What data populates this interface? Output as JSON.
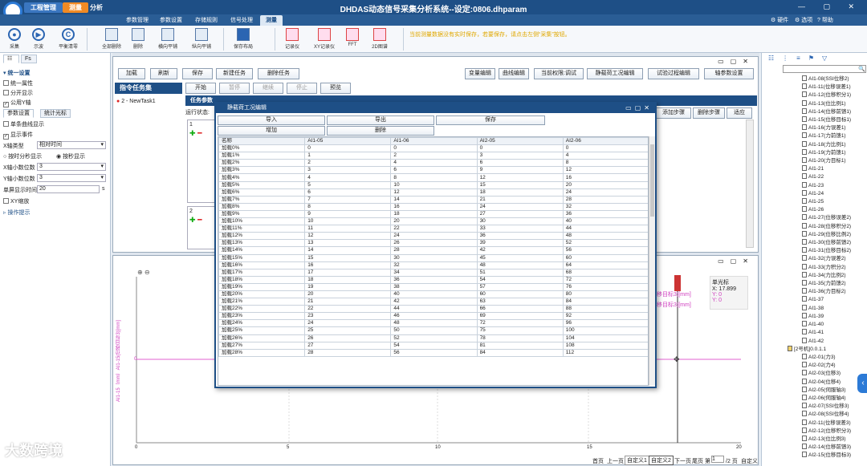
{
  "app": {
    "title": "DHDAS动态信号采集分析系统--设定:0806.dhparam",
    "pills": [
      "工程管理",
      "测量",
      "分析"
    ],
    "window_controls": "— ▢ ✕"
  },
  "menu": {
    "items": [
      "参数管理",
      "参数设置",
      "存储规则",
      "信号处理",
      "测量"
    ],
    "right": [
      "硬件",
      "选项",
      "帮助"
    ]
  },
  "ribbon": {
    "buttons": [
      "采集",
      "示波",
      "平衡清零",
      "全部删除",
      "删除",
      "横向平铺",
      "纵向平铺",
      "保存布局",
      "记录仪",
      "XY记录仪",
      "FFT",
      "2D图谱"
    ],
    "notice": "当前测量数据没有实时保存，若要保存，请点击左侧“采集”按钮。"
  },
  "left": {
    "tabs": [
      "Fs"
    ],
    "section": "统一设置",
    "items": [
      "统一属性",
      "分开显示",
      "公用Y轴"
    ],
    "subtabs": [
      "参数设置",
      "统计光标"
    ],
    "options": [
      "单条曲线显示",
      "显示事件"
    ],
    "xaxis_label": "X轴类型",
    "xaxis_value": "相对时间",
    "radio": [
      "按时分秒显示",
      "按秒显示"
    ],
    "xdec_label": "X轴小数位数",
    "xdec_value": "3",
    "ydec_label": "Y轴小数位数",
    "ydec_value": "3",
    "single_label": "单屏显示时间",
    "single_value": "20",
    "single_unit": "s",
    "xy_zoom": "XY缩放",
    "tips": "操作提示"
  },
  "topwin": {
    "toolbar": [
      "加载",
      "刷新",
      "保存",
      "新建任务",
      "删除任务"
    ],
    "right_toolbar": [
      "变量编辑",
      "曲线编辑",
      "当前权限:调试",
      "静载荷工况编辑",
      "试验过程编辑",
      "轴参数设置"
    ],
    "task_header": "指令任务集",
    "task": "2 - NewTask1",
    "exec": [
      "开始",
      "暂停",
      "继续",
      "停止",
      "预览"
    ],
    "task_param": "任务参数",
    "status": "运行状态:",
    "step_btns": [
      "添加步骤",
      "删除步骤",
      "适应"
    ],
    "step1": "1",
    "step2": "2"
  },
  "dialog": {
    "title": "静载荷工况编辑",
    "buttons": [
      "导入",
      "导出",
      "保存",
      "增加",
      "删除"
    ],
    "columns": [
      "名称",
      "AI1-05",
      "AI1-06",
      "AI2-05",
      "AI2-06"
    ],
    "rows": [
      [
        "加载0%",
        "0",
        "0",
        "0",
        "0"
      ],
      [
        "加载1%",
        "1",
        "2",
        "3",
        "4"
      ],
      [
        "加载2%",
        "2",
        "4",
        "6",
        "8"
      ],
      [
        "加载3%",
        "3",
        "6",
        "9",
        "12"
      ],
      [
        "加载4%",
        "4",
        "8",
        "12",
        "16"
      ],
      [
        "加载5%",
        "5",
        "10",
        "15",
        "20"
      ],
      [
        "加载6%",
        "6",
        "12",
        "18",
        "24"
      ],
      [
        "加载7%",
        "7",
        "14",
        "21",
        "28"
      ],
      [
        "加载8%",
        "8",
        "16",
        "24",
        "32"
      ],
      [
        "加载9%",
        "9",
        "18",
        "27",
        "36"
      ],
      [
        "加载10%",
        "10",
        "20",
        "30",
        "40"
      ],
      [
        "加载11%",
        "11",
        "22",
        "33",
        "44"
      ],
      [
        "加载12%",
        "12",
        "24",
        "36",
        "48"
      ],
      [
        "加载13%",
        "13",
        "26",
        "39",
        "52"
      ],
      [
        "加载14%",
        "14",
        "28",
        "42",
        "56"
      ],
      [
        "加载15%",
        "15",
        "30",
        "45",
        "60"
      ],
      [
        "加载16%",
        "16",
        "32",
        "48",
        "64"
      ],
      [
        "加载17%",
        "17",
        "34",
        "51",
        "68"
      ],
      [
        "加载18%",
        "18",
        "36",
        "54",
        "72"
      ],
      [
        "加载19%",
        "19",
        "38",
        "57",
        "76"
      ],
      [
        "加载20%",
        "20",
        "40",
        "60",
        "80"
      ],
      [
        "加载21%",
        "21",
        "42",
        "63",
        "84"
      ],
      [
        "加载22%",
        "22",
        "44",
        "66",
        "88"
      ],
      [
        "加载23%",
        "23",
        "46",
        "69",
        "92"
      ],
      [
        "加载24%",
        "24",
        "48",
        "72",
        "96"
      ],
      [
        "加载25%",
        "25",
        "50",
        "75",
        "100"
      ],
      [
        "加载26%",
        "26",
        "52",
        "78",
        "104"
      ],
      [
        "加载27%",
        "27",
        "54",
        "81",
        "108"
      ],
      [
        "加载28%",
        "28",
        "56",
        "84",
        "112"
      ]
    ]
  },
  "plot": {
    "ylabel": "AI1-15（mm）AI1-15(位移目标3)[mm]",
    "cursor_title": "单光标",
    "cursor_x": "X: 17.899",
    "cursor_y1": "Y: 0",
    "cursor_y2": "Y: 0",
    "legend1": "移目标3)[mm]",
    "legend2": "移目标3)[mm]",
    "xticks": [
      "0",
      "5",
      "10",
      "15",
      "20"
    ],
    "yticks": [
      "0"
    ]
  },
  "pager": {
    "first": "首页",
    "prev": "上一页",
    "tab1": "自定义1",
    "tab2": "自定义2",
    "tab3": "自定义3",
    "next": "下一页",
    "last": "尾页",
    "page_label": "第",
    "page_value": "1",
    "page_total": "/2 页",
    "page_end": "自定义"
  },
  "tree": {
    "items": [
      "AI1-08(SSI位移2)",
      "AI1-11(位移误差1)",
      "AI1-12(位移积分1)",
      "AI1-13(位比例1)",
      "AI1-14(位移前馈1)",
      "AI1-15(位移目标1)",
      "AI1-16(力误差1)",
      "AI1-17(力前馈1)",
      "AI1-18(力比例1)",
      "AI1-19(力前馈1)",
      "AI1-20(力目标1)",
      "AI1-21",
      "AI1-22",
      "AI1-23",
      "AI1-24",
      "AI1-25",
      "AI1-26",
      "AI1-27(位移误差2)",
      "AI1-28(位移积分2)",
      "AI1-29(位移比例2)",
      "AI1-30(位移前馈2)",
      "AI1-31(位移目标2)",
      "AI1-32(力误差2)",
      "AI1-33(力积分2)",
      "AI1-34(力比例2)",
      "AI1-35(力前馈2)",
      "AI1-36(力目标2)",
      "AI1-37",
      "AI1-38",
      "AI1-39",
      "AI1-40",
      "AI1-41",
      "AI1-42",
      "[2号机]0.0.1.1",
      "AI2-01(力3)",
      "AI2-02(力4)",
      "AI2-03(位移3)",
      "AI2-04(位移4)",
      "AI2-05(伺服轴3)",
      "AI2-06(伺服轴4)",
      "AI2-07(SSI位移3)",
      "AI2-08(SSI位移4)",
      "AI2-11(位移误差3)",
      "AI2-12(位移积分3)",
      "AI2-13(位比例3)",
      "AI2-14(位移前馈3)",
      "AI2-15(位移目标3)"
    ]
  },
  "watermark": "大数跨境"
}
